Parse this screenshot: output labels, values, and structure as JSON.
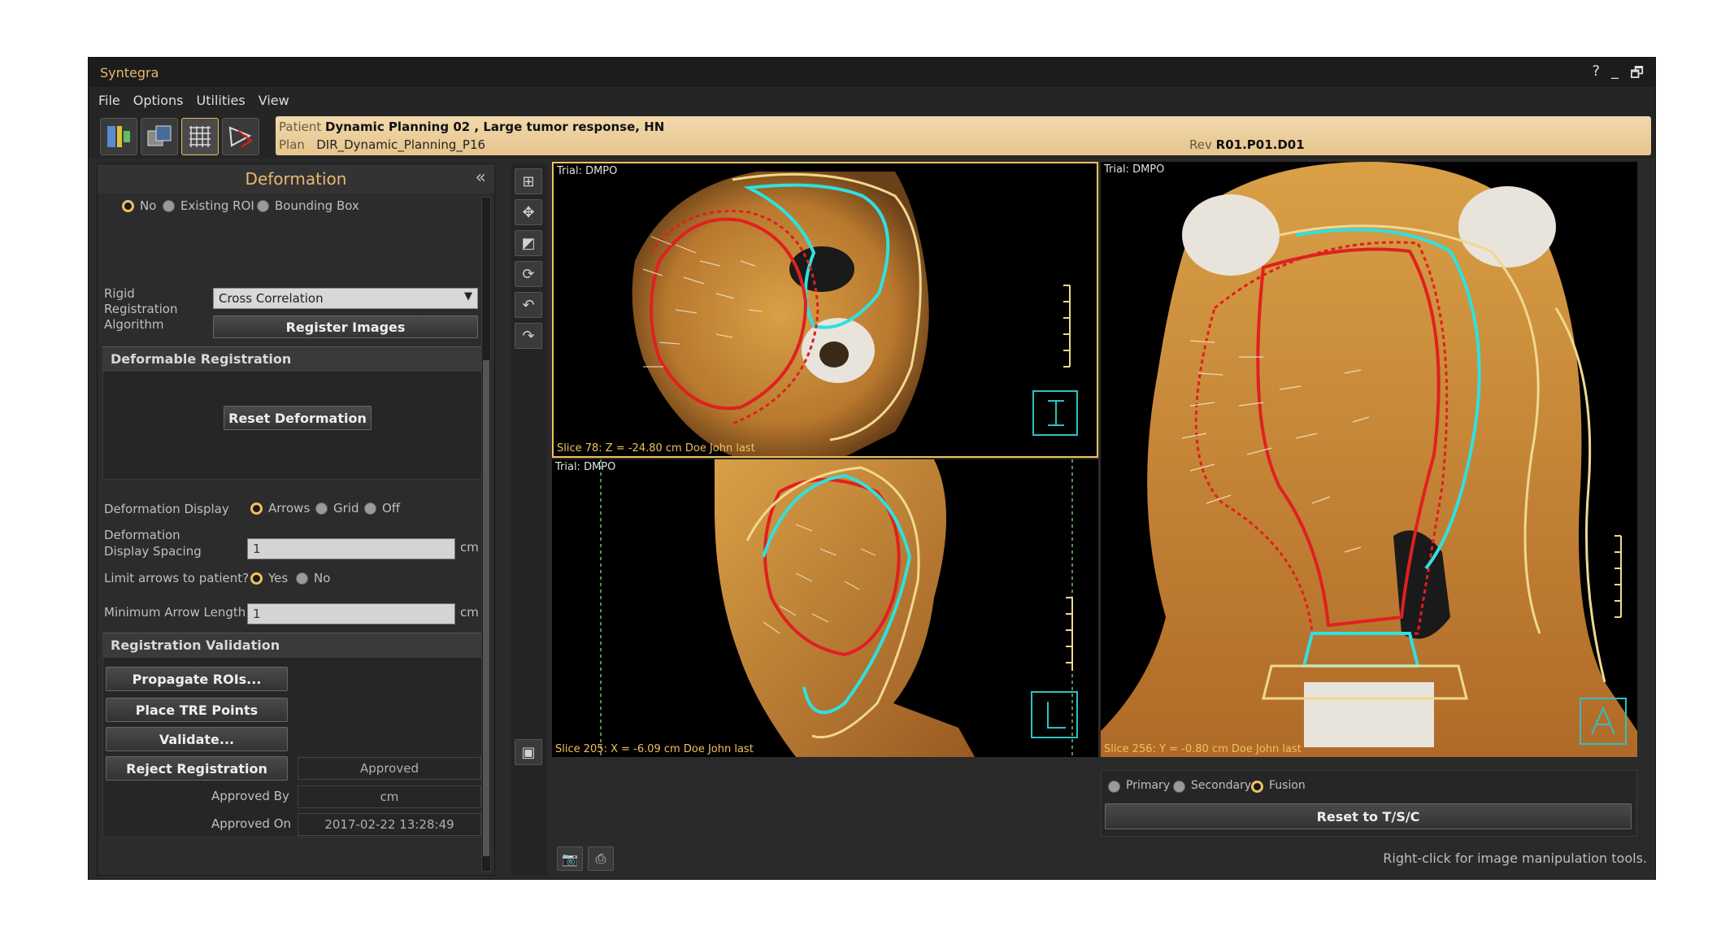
{
  "app": {
    "title": "Syntegra",
    "window_controls": [
      "?",
      "_",
      "🗗"
    ]
  },
  "menu": [
    "File",
    "Options",
    "Utilities",
    "View"
  ],
  "toolbar": {
    "icons": [
      "registration-icon",
      "image-compare-icon",
      "deformation-grid-icon",
      "contour-transfer-icon"
    ]
  },
  "patient_bar": {
    "patient_label": "Patient",
    "patient_value": "Dynamic Planning 02 , Large tumor response, HN",
    "plan_label": "Plan",
    "plan_value": "DIR_Dynamic_Planning_P16",
    "rev_label": "Rev",
    "rev_value": "R01.P01.D01"
  },
  "panel": {
    "title": "Deformation",
    "collapse_glyph": "«",
    "roi_options": [
      "No",
      "Existing ROI",
      "Bounding Box"
    ],
    "rigid": {
      "label": "Rigid Registration Algorithm",
      "algorithm": "Cross Correlation",
      "register_button": "Register Images"
    },
    "deformable": {
      "header": "Deformable Registration",
      "reset_button": "Reset Deformation",
      "display_label": "Deformation Display",
      "display_options": [
        "Arrows",
        "Grid",
        "Off"
      ],
      "spacing_label": "Deformation Display Spacing",
      "spacing_value": "1",
      "spacing_unit": "cm",
      "limit_label": "Limit arrows to patient?",
      "limit_options": [
        "Yes",
        "No"
      ],
      "min_arrow_label": "Minimum Arrow Length",
      "min_arrow_value": "1",
      "min_arrow_unit": "cm"
    },
    "validation": {
      "header": "Registration Validation",
      "propagate_button": "Propagate ROIs...",
      "tre_button": "Place TRE Points",
      "validate_button": "Validate...",
      "reject_button": "Reject Registration",
      "status": "Approved",
      "approved_by_label": "Approved By",
      "approved_by_value": "cm",
      "approved_on_label": "Approved On",
      "approved_on_value": "2017-02-22 13:28:49"
    }
  },
  "views": {
    "axial": {
      "trial": "Trial: DMPO",
      "slice": "Slice 78: Z = -24.80 cm Doe John last"
    },
    "sagittal": {
      "trial": "Trial: DMPO",
      "slice": "Slice 205: X = -6.09 cm Doe John last"
    },
    "coronal": {
      "trial": "Trial: DMPO",
      "slice": "Slice 256: Y = -0.80 cm Doe John last"
    }
  },
  "fusion": {
    "options": [
      "Primary",
      "Secondary",
      "Fusion"
    ],
    "selected": "Fusion",
    "reset_button": "Reset to T/S/C"
  },
  "hint": "Right-click for image manipulation tools.",
  "colors": {
    "accent": "#f0c060",
    "contour_red": "#e02020",
    "contour_cyan": "#30e0e0",
    "contour_yellow": "#f0d890",
    "tissue": "#c98a3a"
  }
}
